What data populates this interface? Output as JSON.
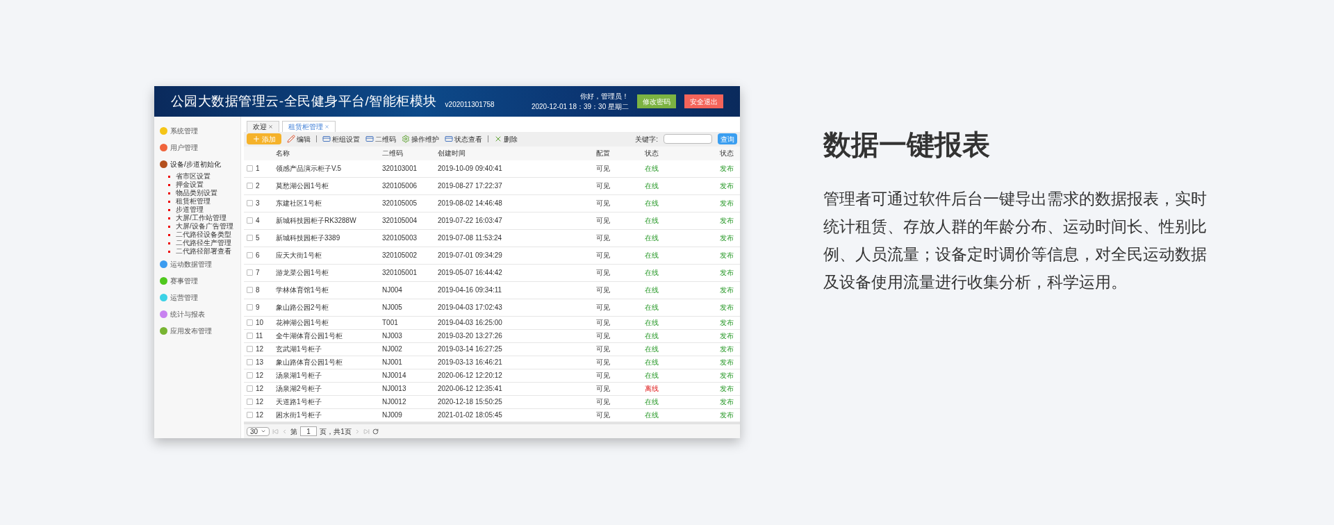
{
  "header": {
    "title": "公园大数据管理云-全民健身平台/智能柜模块",
    "version": "v202011301758",
    "greeting": "你好，管理员！",
    "datetime": "2020-12-01 18：39：30 星期二",
    "buttons": [
      {
        "label": "修改密码",
        "kind": "green"
      },
      {
        "label": "安全退出",
        "kind": "red"
      }
    ]
  },
  "sidebar": {
    "items": [
      {
        "label": "系统管理",
        "color": "#f5c518",
        "expanded": false
      },
      {
        "label": "用户管理",
        "color": "#f0643c",
        "expanded": false
      },
      {
        "label": "设备/步道初始化",
        "color": "#b4501e",
        "expanded": true,
        "children": [
          "省市区设置",
          "押金设置",
          "物品类别设置",
          "租赁柜管理",
          "步道管理",
          "大屏/工作站管理",
          "大屏/设备广告管理",
          "二代路径设备类型",
          "二代路径生产管理",
          "二代路径部署查看"
        ]
      },
      {
        "label": "运动数据管理",
        "color": "#3c9cf0",
        "expanded": false
      },
      {
        "label": "赛事管理",
        "color": "#50c81e",
        "expanded": false
      },
      {
        "label": "运营管理",
        "color": "#3cd2e6",
        "expanded": false
      },
      {
        "label": "统计与报表",
        "color": "#c882f0",
        "expanded": false
      },
      {
        "label": "应用发布管理",
        "color": "#78b432",
        "expanded": false
      }
    ]
  },
  "tabs": [
    {
      "label": "欢迎",
      "selected": false
    },
    {
      "label": "租赁柜管理",
      "selected": true
    }
  ],
  "toolbar": {
    "buttons": [
      {
        "label": "添加",
        "kind": "add"
      },
      {
        "label": "编辑",
        "kind": "edit"
      },
      {
        "label": "柜组设置",
        "kind": "card"
      },
      {
        "label": "二维码",
        "kind": "card"
      },
      {
        "label": "操作维护",
        "kind": "gear"
      },
      {
        "label": "状态查看",
        "kind": "card"
      },
      {
        "label": "删除",
        "kind": "delete"
      }
    ],
    "keyword_label": "关键字:",
    "search_button": "查询"
  },
  "table": {
    "columns": [
      "名称",
      "二维码",
      "创建时间",
      "配置",
      "状态",
      "状态"
    ],
    "rows": [
      {
        "checked": false,
        "no": "1",
        "name": "领感产品演示柜子V.5",
        "qr": "320103001",
        "created": "2019-10-09 09:40:41",
        "config": "可见",
        "status": "在线",
        "online": true,
        "publish": "发布"
      },
      {
        "checked": false,
        "no": "2",
        "name": "莫愁湖公园1号柜",
        "qr": "320105006",
        "created": "2019-08-27 17:22:37",
        "config": "可见",
        "status": "在线",
        "online": true,
        "publish": "发布"
      },
      {
        "checked": false,
        "no": "3",
        "name": "东建社区1号柜",
        "qr": "320105005",
        "created": "2019-08-02 14:46:48",
        "config": "可见",
        "status": "在线",
        "online": true,
        "publish": "发布"
      },
      {
        "checked": false,
        "no": "4",
        "name": "新城科技园柜子RK3288W",
        "qr": "320105004",
        "created": "2019-07-22 16:03:47",
        "config": "可见",
        "status": "在线",
        "online": true,
        "publish": "发布"
      },
      {
        "checked": false,
        "no": "5",
        "name": "新城科技园柜子3389",
        "qr": "320105003",
        "created": "2019-07-08 11:53:24",
        "config": "可见",
        "status": "在线",
        "online": true,
        "publish": "发布"
      },
      {
        "checked": false,
        "no": "6",
        "name": "应天大街1号柜",
        "qr": "320105002",
        "created": "2019-07-01 09:34:29",
        "config": "可见",
        "status": "在线",
        "online": true,
        "publish": "发布"
      },
      {
        "checked": false,
        "no": "7",
        "name": "游龙菜公园1号柜",
        "qr": "320105001",
        "created": "2019-05-07 16:44:42",
        "config": "可见",
        "status": "在线",
        "online": true,
        "publish": "发布"
      },
      {
        "checked": false,
        "no": "8",
        "name": "学林体育馆1号柜",
        "qr": "NJ004",
        "created": "2019-04-16 09:34:11",
        "config": "可见",
        "status": "在线",
        "online": true,
        "publish": "发布"
      },
      {
        "checked": false,
        "no": "9",
        "name": "象山路公园2号柜",
        "qr": "NJ005",
        "created": "2019-04-03 17:02:43",
        "config": "可见",
        "status": "在线",
        "online": true,
        "publish": "发布"
      },
      {
        "checked": false,
        "no": "10",
        "name": "花神湖公园1号柜",
        "qr": "T001",
        "created": "2019-04-03 16:25:00",
        "config": "可见",
        "status": "在线",
        "online": true,
        "publish": "发布"
      },
      {
        "checked": false,
        "no": "11",
        "name": "全牛湖体育公园1号柜",
        "qr": "NJ003",
        "created": "2019-03-20 13:27:26",
        "config": "可见",
        "status": "在线",
        "online": true,
        "publish": "发布"
      },
      {
        "checked": false,
        "no": "12",
        "name": "玄武湖1号柜子",
        "qr": "NJ002",
        "created": "2019-03-14 16:27:25",
        "config": "可见",
        "status": "在线",
        "online": true,
        "publish": "发布"
      },
      {
        "checked": false,
        "no": "13",
        "name": "象山路体育公园1号柜",
        "qr": "NJ001",
        "created": "2019-03-13 16:46:21",
        "config": "可见",
        "status": "在线",
        "online": true,
        "publish": "发布"
      },
      {
        "checked": false,
        "no": "12",
        "name": "汤泉湖1号柜子",
        "qr": "NJ0014",
        "created": "2020-06-12 12:20:12",
        "config": "可见",
        "status": "在线",
        "online": true,
        "publish": "发布"
      },
      {
        "checked": false,
        "no": "12",
        "name": "汤泉湖2号柜子",
        "qr": "NJ0013",
        "created": "2020-06-12 12:35:41",
        "config": "可见",
        "status": "离线",
        "online": false,
        "publish": "发布"
      },
      {
        "checked": false,
        "no": "12",
        "name": "天道路1号柜子",
        "qr": "NJ0012",
        "created": "2020-12-18 15:50:25",
        "config": "可见",
        "status": "在线",
        "online": true,
        "publish": "发布"
      },
      {
        "checked": false,
        "no": "12",
        "name": "困水街1号柜子",
        "qr": "NJ009",
        "created": "2021-01-02 18:05:45",
        "config": "可见",
        "status": "在线",
        "online": true,
        "publish": "发布"
      }
    ]
  },
  "pagination": {
    "page_size": "30",
    "page_prefix": "第",
    "page": "1",
    "page_suffix": "页，共1页"
  },
  "feature": {
    "heading": "数据一键报表",
    "text": "管理者可通过软件后台一键导出需求的数据报表，实时统计租赁、存放人群的年龄分布、运动时间长、性别比例、人员流量；设备定时调价等信息，对全民运动数据及设备使用流量进行收集分析，科学运用。"
  }
}
